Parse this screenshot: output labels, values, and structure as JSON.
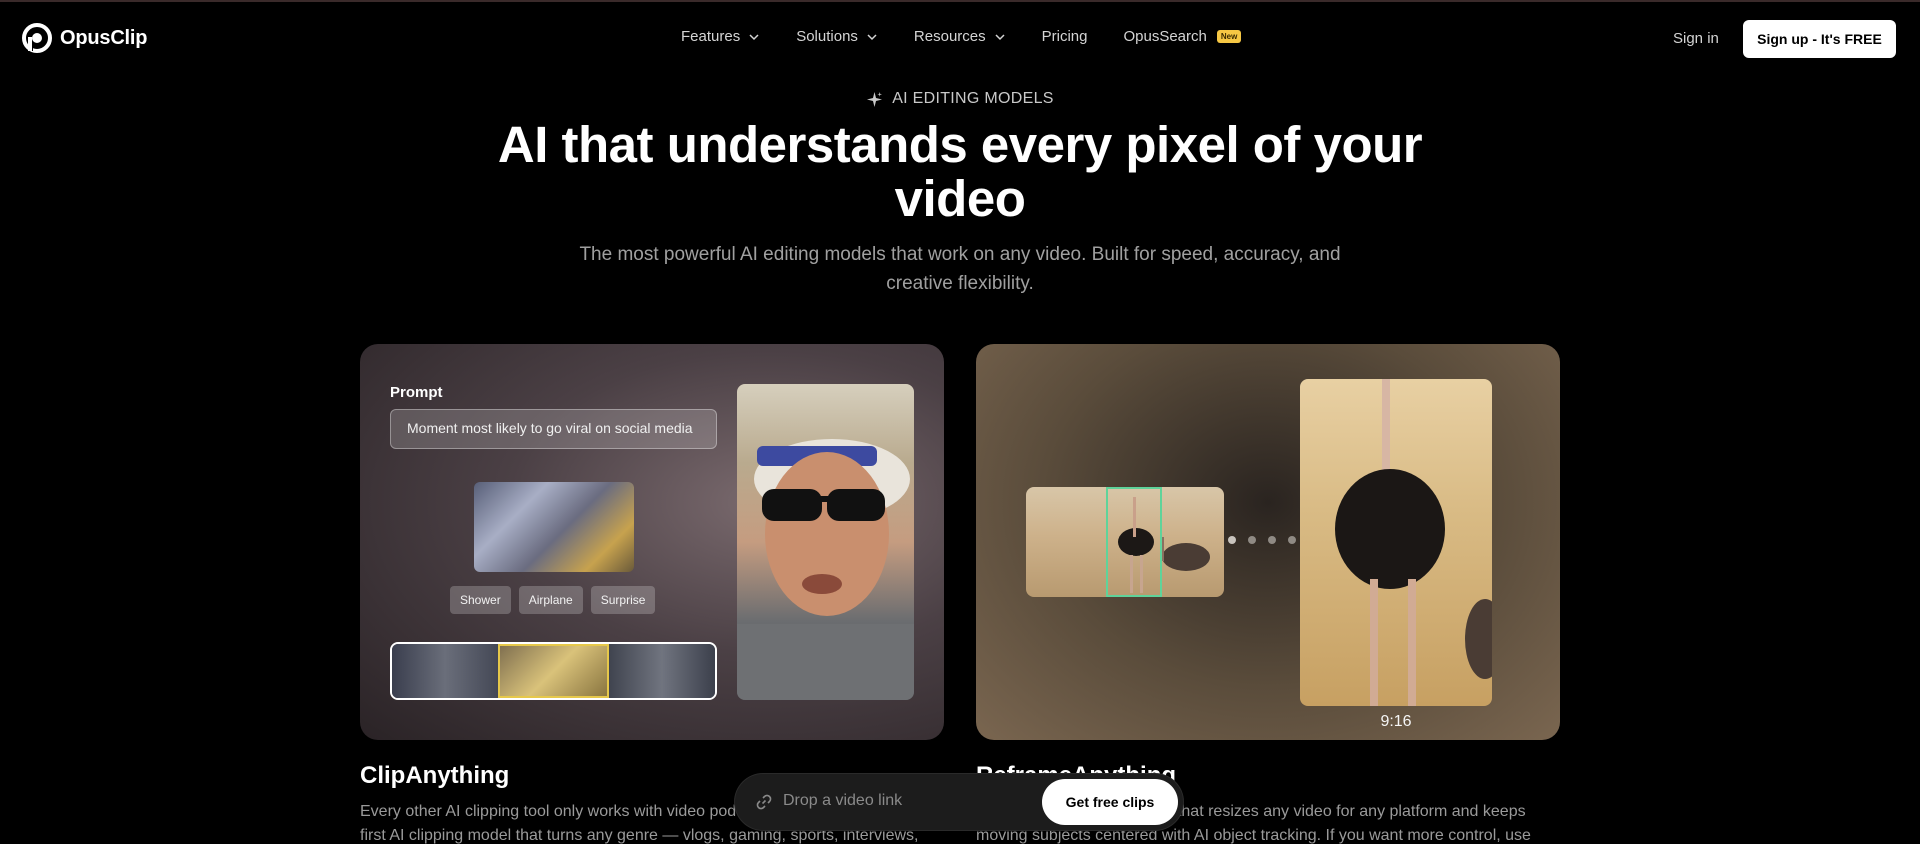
{
  "brand": {
    "name": "OpusClip",
    "logo_icon": "opusclip-logo-icon"
  },
  "nav": {
    "items": [
      {
        "label": "Features",
        "has_dropdown": true
      },
      {
        "label": "Solutions",
        "has_dropdown": true
      },
      {
        "label": "Resources",
        "has_dropdown": true
      },
      {
        "label": "Pricing",
        "has_dropdown": false
      },
      {
        "label": "OpusSearch",
        "badge": "New",
        "has_dropdown": false
      }
    ],
    "signin": "Sign in",
    "signup": "Sign up - It's FREE"
  },
  "hero": {
    "eyebrow": "AI EDITING MODELS",
    "eyebrow_icon": "sparkle-icon",
    "headline": "AI that understands every pixel of your video",
    "subhead": "The most powerful AI editing models that work on any video. Built for speed, accuracy, and creative flexibility."
  },
  "clip_card": {
    "prompt_label": "Prompt",
    "prompt_value": "Moment most likely to go viral on social media",
    "tags": [
      "Shower",
      "Airplane",
      "Surprise"
    ]
  },
  "reframe_card": {
    "aspect_ratio": "9:16"
  },
  "sections": {
    "left_title": "ClipAnything",
    "left_desc": "Every other AI clipping tool only works with video podcasts. ClipAnything is the first AI clipping model that turns any genre — vlogs, gaming, sports, interviews, explainer",
    "right_title": "ReframeAnything",
    "right_desc": "The first AI reframing model that resizes any video for any platform and keeps moving subjects centered with AI object tracking. If you want more control, use manual"
  },
  "dropbar": {
    "placeholder": "Drop a video link",
    "button": "Get free clips",
    "link_icon": "link-icon"
  },
  "colors": {
    "background": "#000000",
    "primary_button": "#ffffff",
    "badge": "#f6c744",
    "tracking_box": "#5fd39a"
  }
}
